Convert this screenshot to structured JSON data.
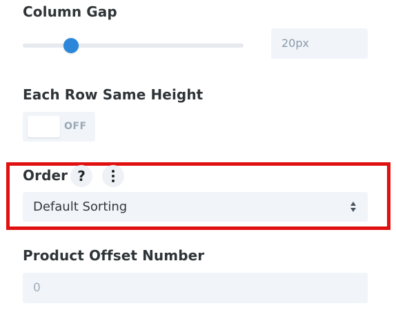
{
  "column_gap": {
    "label": "Column Gap",
    "value": "20px",
    "slider_position": 0.22
  },
  "row_same_height": {
    "label": "Each Row Same Height",
    "toggle_text": "OFF",
    "state": "off"
  },
  "order": {
    "label": "Order",
    "help_icon": "?",
    "more_icon": "vertical-ellipsis",
    "selected": "Default Sorting"
  },
  "product_offset": {
    "label": "Product Offset Number",
    "value": "0"
  },
  "colors": {
    "slider_handle": "#2b87da",
    "highlight_border": "#e01010",
    "field_background": "#f1f5f9"
  }
}
